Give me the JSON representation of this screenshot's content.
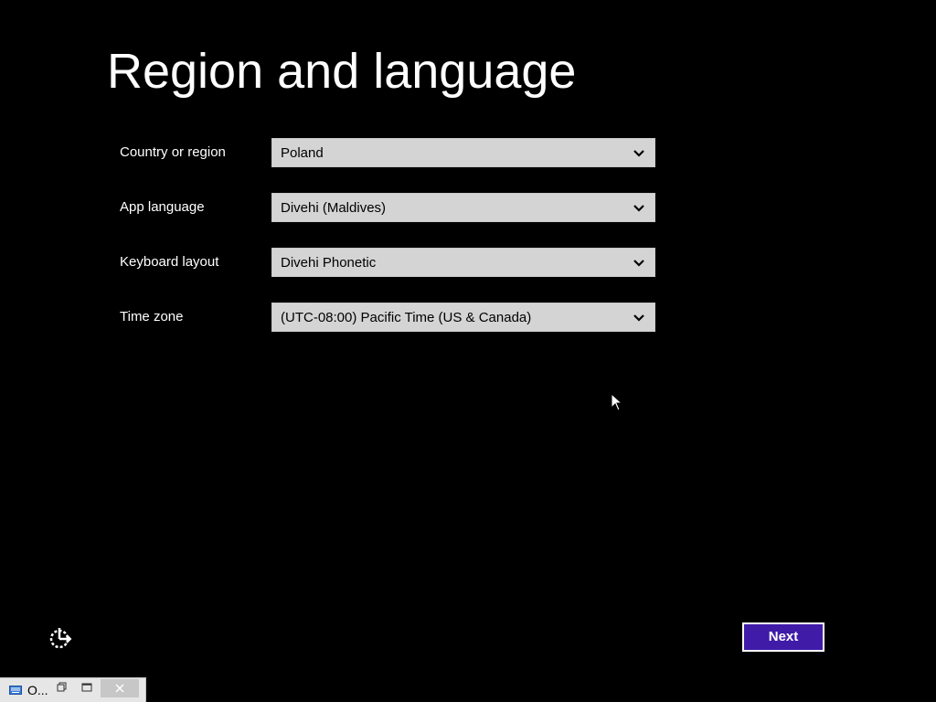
{
  "page": {
    "title": "Region and language"
  },
  "fields": [
    {
      "label": "Country or region",
      "value": "Poland"
    },
    {
      "label": "App language",
      "value": "Divehi (Maldives)"
    },
    {
      "label": "Keyboard layout",
      "value": "Divehi Phonetic"
    },
    {
      "label": "Time zone",
      "value": "(UTC-08:00) Pacific Time (US & Canada)"
    }
  ],
  "actions": {
    "next_label": "Next"
  },
  "icons": {
    "ease_of_access": "ease-of-access-icon",
    "dropdown": "chevron-down-icon",
    "cursor": "mouse-pointer-icon",
    "keyboard": "keyboard-icon",
    "restore": "restore-icon",
    "maximize": "maximize-icon",
    "close": "close-icon"
  },
  "taskbar": {
    "label": "O..."
  },
  "colors": {
    "background": "#000000",
    "accent": "#3f1ba8",
    "select_bg": "#d4d4d4",
    "text": "#ffffff"
  }
}
